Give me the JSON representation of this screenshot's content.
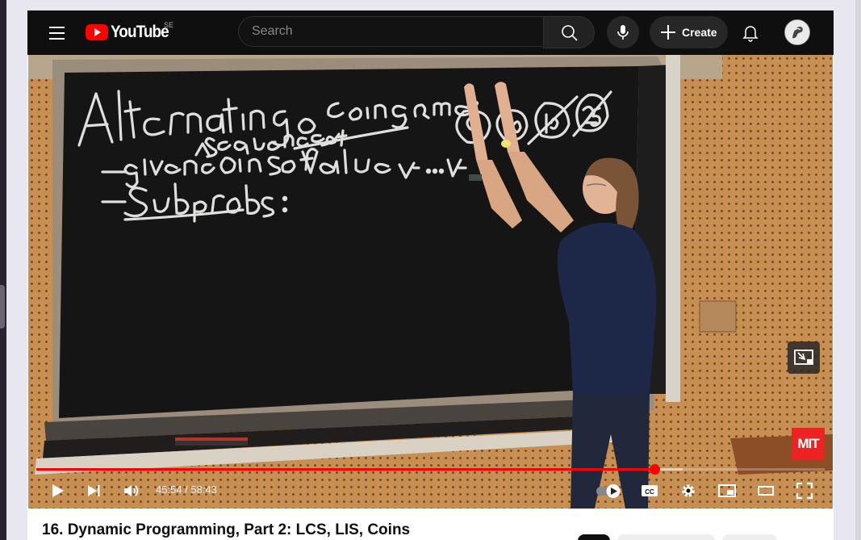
{
  "header": {
    "logo_text": "YouTube",
    "country_code": "SE",
    "search_placeholder": "Search",
    "create_label": "Create"
  },
  "player": {
    "current_time": "45:54",
    "separator": " / ",
    "duration": "58:43",
    "progress_fraction": 0.784,
    "buffered_fraction": 0.82,
    "channel_badge": "MIT",
    "board_text": {
      "heading": "Alternating coin game:",
      "line1": "- given coins of value V₀ ... Vₙ",
      "line1_insert": "sequence of",
      "line2": "- Subprobs:",
      "circled": [
        "8",
        "10",
        "100",
        "25"
      ]
    }
  },
  "video": {
    "title": "16. Dynamic Programming, Part 2: LCS, LIS, Coins"
  },
  "colors": {
    "brand_red": "#ff0000",
    "topbar_bg": "#0f0f0f",
    "chalkboard": "#151515"
  },
  "icons": [
    "menu-icon",
    "youtube-logo-icon",
    "search-icon",
    "microphone-icon",
    "plus-icon",
    "bell-icon",
    "avatar-icon",
    "play-icon",
    "next-icon",
    "volume-icon",
    "autoplay-toggle-icon",
    "captions-icon",
    "settings-icon",
    "miniplayer-icon",
    "theater-mode-icon",
    "fullscreen-icon"
  ]
}
